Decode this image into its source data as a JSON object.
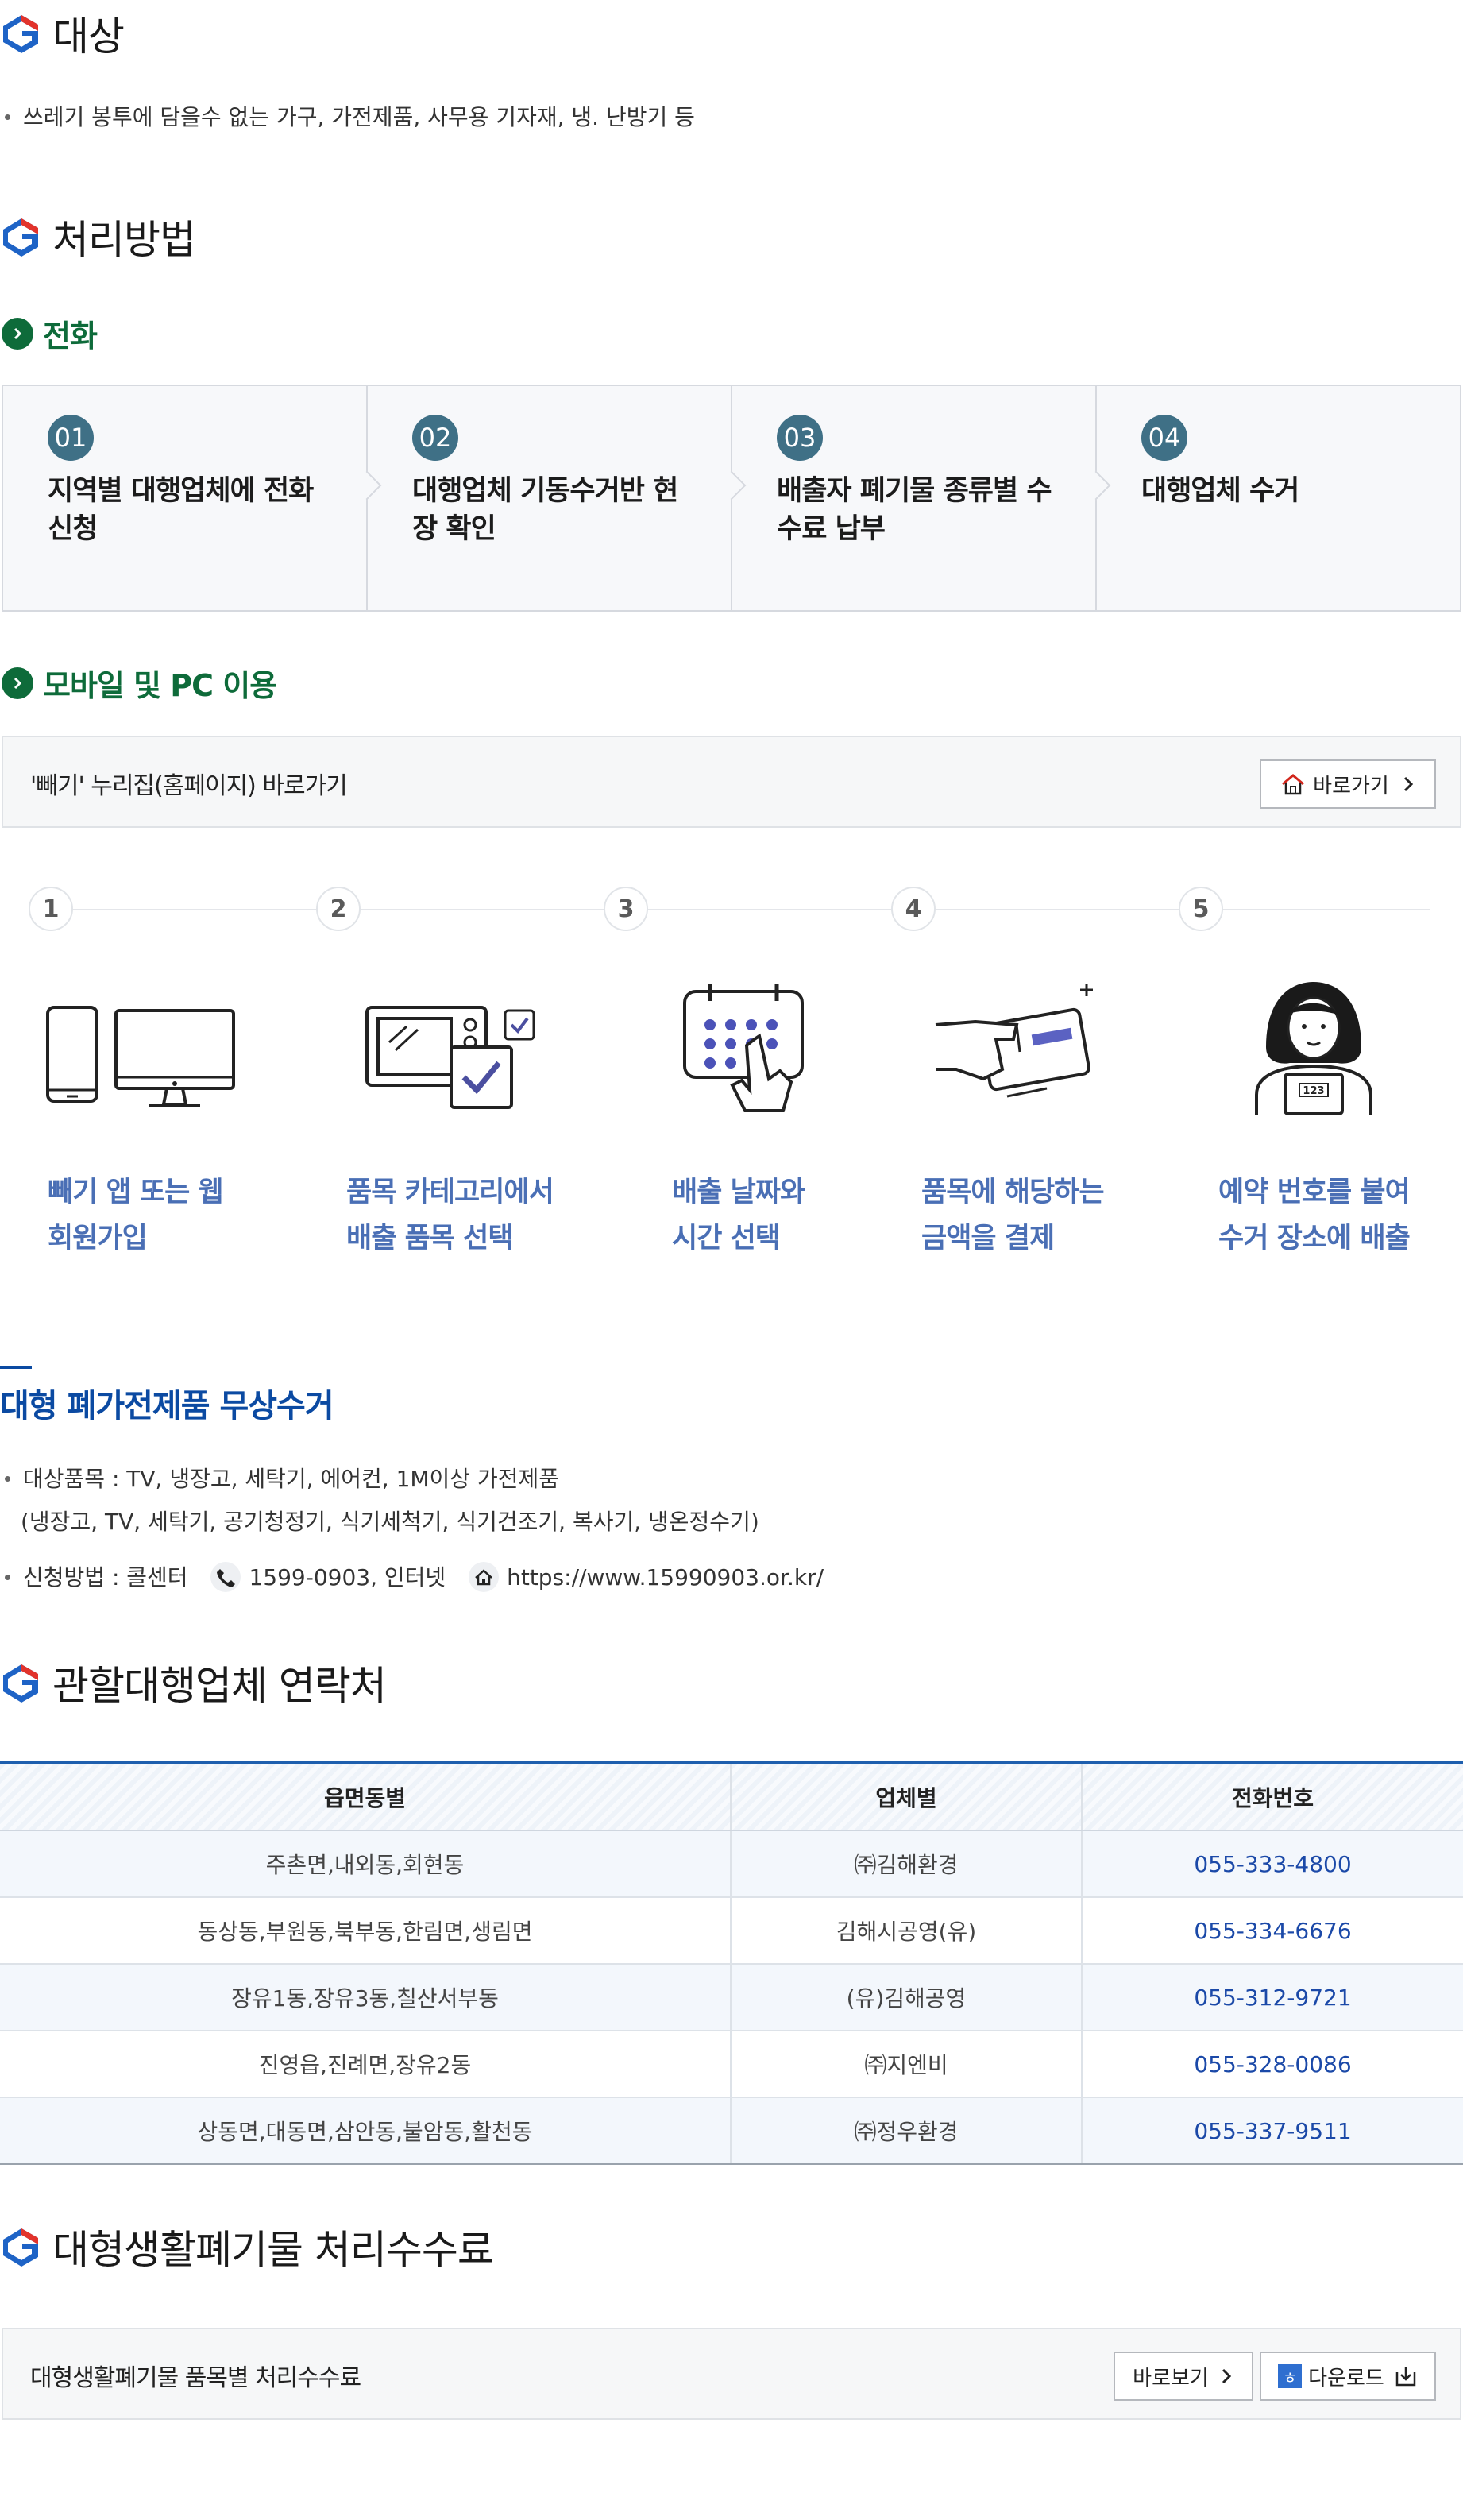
{
  "sections": {
    "target": {
      "heading": "대상",
      "items": [
        "쓰레기 봉투에 담을수 없는 가구, 가전제품, 사무용 기자재, 냉. 난방기 등"
      ]
    },
    "method": {
      "heading": "처리방법",
      "phone": {
        "heading": "전화",
        "steps": [
          {
            "num": "01",
            "desc_line1": "지역별 대행업체에 전화",
            "desc_line2": "신청"
          },
          {
            "num": "02",
            "desc_line1": "대행업체 기동수거반 현",
            "desc_line2": "장 확인"
          },
          {
            "num": "03",
            "desc_line1": "배출자 폐기물 종류별 수",
            "desc_line2": "수료 납부"
          },
          {
            "num": "04",
            "desc_line1": "대행업체 수거",
            "desc_line2": ""
          }
        ]
      },
      "mobile": {
        "heading": "모바일 및 PC 이용",
        "link_label": "'빼기' 누리집(홈페이지) 바로가기",
        "link_button": "바로가기",
        "steps": [
          {
            "num": "1",
            "line1": "빼기 앱 또는 웹",
            "line2": "회원가입"
          },
          {
            "num": "2",
            "line1": "품목 카테고리에서",
            "line2": "배출 품목 선택"
          },
          {
            "num": "3",
            "line1": "배출 날짜와",
            "line2": "시간 선택"
          },
          {
            "num": "4",
            "line1": "품목에 해당하는",
            "line2": "금액을 결제"
          },
          {
            "num": "5",
            "line1": "예약 번호를 붙여",
            "line2": "수거 장소에 배출"
          }
        ],
        "icons": [
          "devices-icon",
          "microwave-checklist-icon",
          "calendar-touch-icon",
          "card-payment-icon",
          "person-number-icon"
        ],
        "reservation_number": "123"
      }
    },
    "free_pickup": {
      "heading": "대형 폐가전제품 무상수거",
      "items_label": "대상품목 : TV, 냉장고, 세탁기, 에어컨, 1M이상 가전제품",
      "items_sub": "(냉장고, TV, 세탁기, 공기청정기, 식기세척기, 식기건조기, 복사기, 냉온정수기)",
      "apply_prefix": "신청방법 : 콜센터",
      "apply_phone": "1599-0903, 인터넷",
      "apply_url": "https://www.15990903.or.kr/"
    },
    "contacts": {
      "heading": "관할대행업체 연락처",
      "columns": [
        "읍면동별",
        "업체별",
        "전화번호"
      ],
      "rows": [
        {
          "area": "주촌면,내외동,회현동",
          "company": "㈜김해환경",
          "phone": "055-333-4800"
        },
        {
          "area": "동상동,부원동,북부동,한림면,생림면",
          "company": "김해시공영(유)",
          "phone": "055-334-6676"
        },
        {
          "area": "장유1동,장유3동,칠산서부동",
          "company": "(유)김해공영",
          "phone": "055-312-9721"
        },
        {
          "area": "진영읍,진례면,장유2동",
          "company": "㈜지엔비",
          "phone": "055-328-0086"
        },
        {
          "area": "상동면,대동면,삼안동,불암동,활천동",
          "company": "㈜정우환경",
          "phone": "055-337-9511"
        }
      ]
    },
    "fees": {
      "heading": "대형생활폐기물 처리수수료",
      "label": "대형생활폐기물 품목별 처리수수료",
      "view_button": "바로보기",
      "hwp_badge": "ㅎ",
      "download_button": "다운로드"
    }
  },
  "colors": {
    "accent_green": "#0e6b3a",
    "accent_blue": "#0b4aa2",
    "step_circle": "#3f7086",
    "phone_text": "#1b49a8",
    "mobile_step_text": "#4a6fb5"
  }
}
